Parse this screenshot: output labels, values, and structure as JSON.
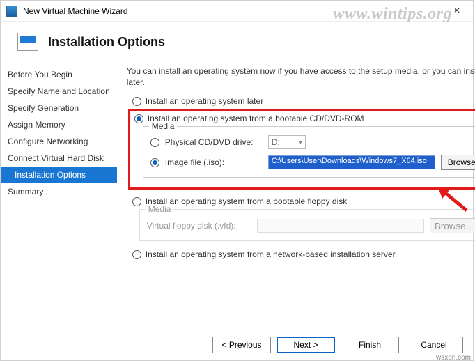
{
  "window": {
    "title": "New Virtual Machine Wizard"
  },
  "header": {
    "title": "Installation Options"
  },
  "watermark": "www.wintips.org",
  "credit": "wsxdn.com",
  "sidebar": {
    "items": [
      {
        "label": "Before You Begin"
      },
      {
        "label": "Specify Name and Location"
      },
      {
        "label": "Specify Generation"
      },
      {
        "label": "Assign Memory"
      },
      {
        "label": "Configure Networking"
      },
      {
        "label": "Connect Virtual Hard Disk"
      },
      {
        "label": "Installation Options"
      },
      {
        "label": "Summary"
      }
    ]
  },
  "main": {
    "intro": "You can install an operating system now if you have access to the setup media, or you can install it later.",
    "option_later": "Install an operating system later",
    "option_cd": "Install an operating system from a bootable CD/DVD-ROM",
    "media_group": "Media",
    "physical_label": "Physical CD/DVD drive:",
    "physical_value": "D:",
    "image_label": "Image file (.iso):",
    "image_path": "C:\\Users\\User\\Downloads\\Windows7_X64.iso",
    "browse": "Browse...",
    "option_floppy": "Install an operating system from a bootable floppy disk",
    "floppy_group": "Media",
    "floppy_label": "Virtual floppy disk (.vfd):",
    "option_network": "Install an operating system from a network-based installation server"
  },
  "footer": {
    "previous": "< Previous",
    "next": "Next >",
    "finish": "Finish",
    "cancel": "Cancel"
  }
}
